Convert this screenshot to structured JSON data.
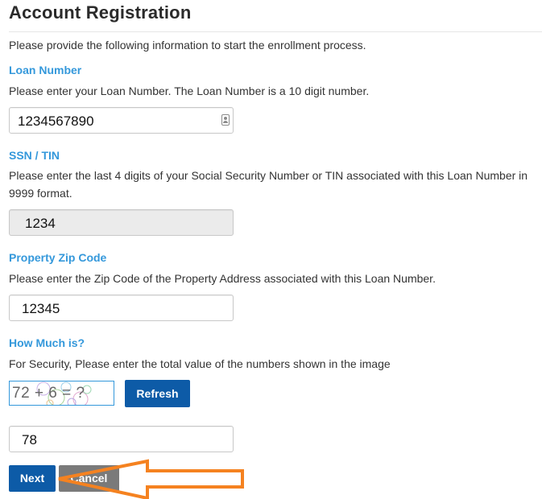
{
  "page": {
    "title": "Account Registration",
    "intro": "Please provide the following information to start the enrollment process."
  },
  "loan": {
    "label": "Loan Number",
    "help": "Please enter your Loan Number. The Loan Number is a 10 digit number.",
    "value": "1234567890"
  },
  "ssn": {
    "label": "SSN / TIN",
    "help": "Please enter the last 4 digits of your Social Security Number or TIN associated with this Loan Number in 9999 format.",
    "value": "1234",
    "disabled": true
  },
  "zip": {
    "label": "Property Zip Code",
    "help": "Please enter the Zip Code of the Property Address associated with this Loan Number.",
    "value": "12345"
  },
  "security": {
    "label": "How Much is?",
    "help": "For Security, Please enter the total value of the numbers shown in the image",
    "captcha_text": "72 + 6 = ?",
    "refresh_label": "Refresh",
    "answer": "78"
  },
  "actions": {
    "next_label": "Next",
    "cancel_label": "Cancel"
  },
  "colors": {
    "label_blue": "#3498db",
    "button_blue": "#0d5ba7",
    "button_gray": "#7a7a7a",
    "annotation_orange": "#f58220"
  },
  "icons": {
    "loan_field_icon": "contact-card-icon",
    "annotation": "arrow-left-icon"
  }
}
